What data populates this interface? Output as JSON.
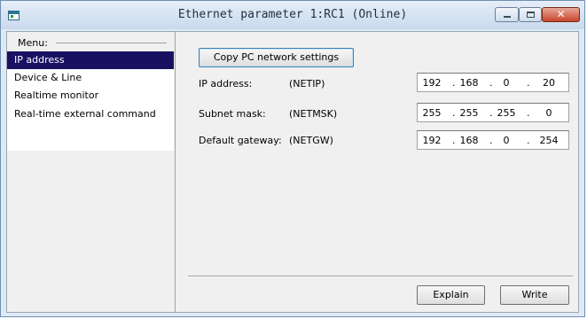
{
  "window": {
    "title": "Ethernet parameter 1:RC1 (Online)",
    "accent": "#1a1062",
    "close_glyph": "✕"
  },
  "sidebar": {
    "header": "Menu:",
    "items": [
      {
        "label": "IP address",
        "selected": true
      },
      {
        "label": "Device & Line",
        "selected": false
      },
      {
        "label": "Realtime monitor",
        "selected": false
      },
      {
        "label": "Real-time external command",
        "selected": false
      }
    ]
  },
  "main": {
    "copy_button": "Copy PC network settings",
    "rows": [
      {
        "label": "IP address:",
        "code": "(NETIP)",
        "octets": [
          "192",
          "168",
          "0",
          "20"
        ]
      },
      {
        "label": "Subnet mask:",
        "code": "(NETMSK)",
        "octets": [
          "255",
          "255",
          "255",
          "0"
        ]
      },
      {
        "label": "Default gateway:",
        "code": "(NETGW)",
        "octets": [
          "192",
          "168",
          "0",
          "254"
        ]
      }
    ],
    "explain_button": "Explain",
    "write_button": "Write"
  }
}
